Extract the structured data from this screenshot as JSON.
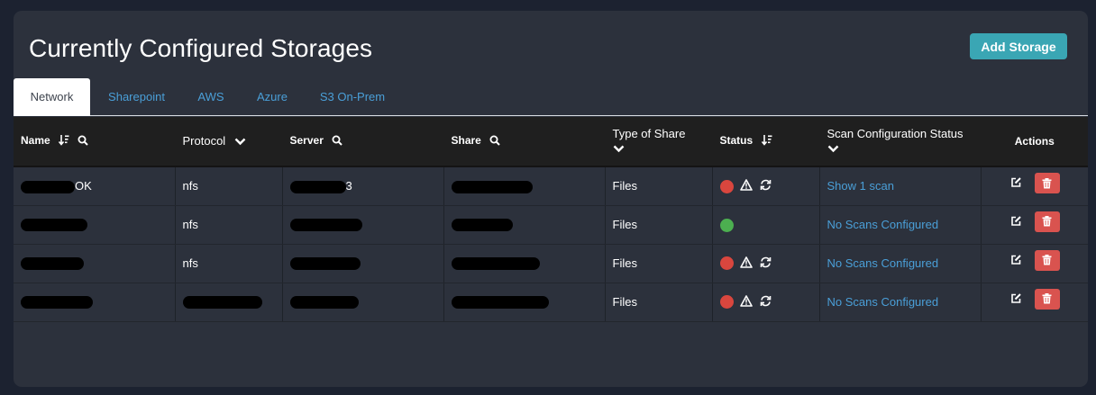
{
  "page": {
    "title": "Currently Configured Storages",
    "add_button": "Add Storage"
  },
  "tabs": [
    {
      "label": "Network",
      "active": true
    },
    {
      "label": "Sharepoint",
      "active": false
    },
    {
      "label": "AWS",
      "active": false
    },
    {
      "label": "Azure",
      "active": false
    },
    {
      "label": "S3 On-Prem",
      "active": false
    }
  ],
  "table": {
    "columns": {
      "name": "Name",
      "protocol": "Protocol",
      "server": "Server",
      "share": "Share",
      "type_line1": "Type of Share",
      "status": "Status",
      "scan_line1": "Scan Configuration Status",
      "actions": "Actions"
    },
    "rows": [
      {
        "name_suffix": "OK",
        "protocol": "nfs",
        "server_suffix": "3",
        "share_suffix": "",
        "type": "Files",
        "status": "error",
        "scan": "Show 1 scan"
      },
      {
        "name_suffix": "",
        "protocol": "nfs",
        "server_suffix": "",
        "share_suffix": "",
        "type": "Files",
        "status": "ok",
        "scan": "No Scans Configured"
      },
      {
        "name_suffix": "",
        "protocol": "nfs",
        "server_suffix": "",
        "share_suffix": "",
        "type": "Files",
        "status": "error",
        "scan": "No Scans Configured"
      },
      {
        "name_suffix": "",
        "protocol": "",
        "server_suffix": "",
        "share_suffix": "",
        "type": "Files",
        "status": "error",
        "scan": "No Scans Configured"
      }
    ]
  },
  "colors": {
    "background": "#1c2230",
    "panel": "#2c313c",
    "accent": "#3aa6b4",
    "link": "#4a9fd8",
    "status_error": "#d9463e",
    "status_ok": "#4caf50",
    "delete": "#d9534f"
  },
  "icons": {
    "sort": "sort-desc-icon",
    "search": "search-icon",
    "chevron": "chevron-down-icon",
    "warning": "warning-icon",
    "refresh": "refresh-icon",
    "edit": "edit-icon",
    "delete": "trash-icon"
  }
}
